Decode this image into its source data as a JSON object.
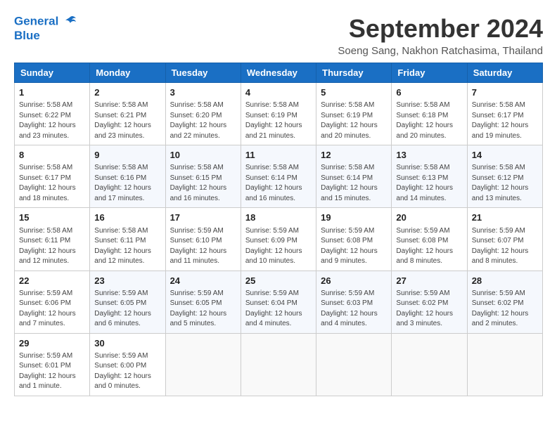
{
  "logo": {
    "line1": "General",
    "line2": "Blue"
  },
  "title": "September 2024",
  "subtitle": "Soeng Sang, Nakhon Ratchasima, Thailand",
  "weekdays": [
    "Sunday",
    "Monday",
    "Tuesday",
    "Wednesday",
    "Thursday",
    "Friday",
    "Saturday"
  ],
  "weeks": [
    [
      {
        "day": "1",
        "sunrise": "5:58 AM",
        "sunset": "6:22 PM",
        "daylight": "12 hours and 23 minutes."
      },
      {
        "day": "2",
        "sunrise": "5:58 AM",
        "sunset": "6:21 PM",
        "daylight": "12 hours and 23 minutes."
      },
      {
        "day": "3",
        "sunrise": "5:58 AM",
        "sunset": "6:20 PM",
        "daylight": "12 hours and 22 minutes."
      },
      {
        "day": "4",
        "sunrise": "5:58 AM",
        "sunset": "6:19 PM",
        "daylight": "12 hours and 21 minutes."
      },
      {
        "day": "5",
        "sunrise": "5:58 AM",
        "sunset": "6:19 PM",
        "daylight": "12 hours and 20 minutes."
      },
      {
        "day": "6",
        "sunrise": "5:58 AM",
        "sunset": "6:18 PM",
        "daylight": "12 hours and 20 minutes."
      },
      {
        "day": "7",
        "sunrise": "5:58 AM",
        "sunset": "6:17 PM",
        "daylight": "12 hours and 19 minutes."
      }
    ],
    [
      {
        "day": "8",
        "sunrise": "5:58 AM",
        "sunset": "6:17 PM",
        "daylight": "12 hours and 18 minutes."
      },
      {
        "day": "9",
        "sunrise": "5:58 AM",
        "sunset": "6:16 PM",
        "daylight": "12 hours and 17 minutes."
      },
      {
        "day": "10",
        "sunrise": "5:58 AM",
        "sunset": "6:15 PM",
        "daylight": "12 hours and 16 minutes."
      },
      {
        "day": "11",
        "sunrise": "5:58 AM",
        "sunset": "6:14 PM",
        "daylight": "12 hours and 16 minutes."
      },
      {
        "day": "12",
        "sunrise": "5:58 AM",
        "sunset": "6:14 PM",
        "daylight": "12 hours and 15 minutes."
      },
      {
        "day": "13",
        "sunrise": "5:58 AM",
        "sunset": "6:13 PM",
        "daylight": "12 hours and 14 minutes."
      },
      {
        "day": "14",
        "sunrise": "5:58 AM",
        "sunset": "6:12 PM",
        "daylight": "12 hours and 13 minutes."
      }
    ],
    [
      {
        "day": "15",
        "sunrise": "5:58 AM",
        "sunset": "6:11 PM",
        "daylight": "12 hours and 12 minutes."
      },
      {
        "day": "16",
        "sunrise": "5:58 AM",
        "sunset": "6:11 PM",
        "daylight": "12 hours and 12 minutes."
      },
      {
        "day": "17",
        "sunrise": "5:59 AM",
        "sunset": "6:10 PM",
        "daylight": "12 hours and 11 minutes."
      },
      {
        "day": "18",
        "sunrise": "5:59 AM",
        "sunset": "6:09 PM",
        "daylight": "12 hours and 10 minutes."
      },
      {
        "day": "19",
        "sunrise": "5:59 AM",
        "sunset": "6:08 PM",
        "daylight": "12 hours and 9 minutes."
      },
      {
        "day": "20",
        "sunrise": "5:59 AM",
        "sunset": "6:08 PM",
        "daylight": "12 hours and 8 minutes."
      },
      {
        "day": "21",
        "sunrise": "5:59 AM",
        "sunset": "6:07 PM",
        "daylight": "12 hours and 8 minutes."
      }
    ],
    [
      {
        "day": "22",
        "sunrise": "5:59 AM",
        "sunset": "6:06 PM",
        "daylight": "12 hours and 7 minutes."
      },
      {
        "day": "23",
        "sunrise": "5:59 AM",
        "sunset": "6:05 PM",
        "daylight": "12 hours and 6 minutes."
      },
      {
        "day": "24",
        "sunrise": "5:59 AM",
        "sunset": "6:05 PM",
        "daylight": "12 hours and 5 minutes."
      },
      {
        "day": "25",
        "sunrise": "5:59 AM",
        "sunset": "6:04 PM",
        "daylight": "12 hours and 4 minutes."
      },
      {
        "day": "26",
        "sunrise": "5:59 AM",
        "sunset": "6:03 PM",
        "daylight": "12 hours and 4 minutes."
      },
      {
        "day": "27",
        "sunrise": "5:59 AM",
        "sunset": "6:02 PM",
        "daylight": "12 hours and 3 minutes."
      },
      {
        "day": "28",
        "sunrise": "5:59 AM",
        "sunset": "6:02 PM",
        "daylight": "12 hours and 2 minutes."
      }
    ],
    [
      {
        "day": "29",
        "sunrise": "5:59 AM",
        "sunset": "6:01 PM",
        "daylight": "12 hours and 1 minute."
      },
      {
        "day": "30",
        "sunrise": "5:59 AM",
        "sunset": "6:00 PM",
        "daylight": "12 hours and 0 minutes."
      },
      null,
      null,
      null,
      null,
      null
    ]
  ],
  "labels": {
    "sunrise": "Sunrise: ",
    "sunset": "Sunset: ",
    "daylight": "Daylight: "
  }
}
